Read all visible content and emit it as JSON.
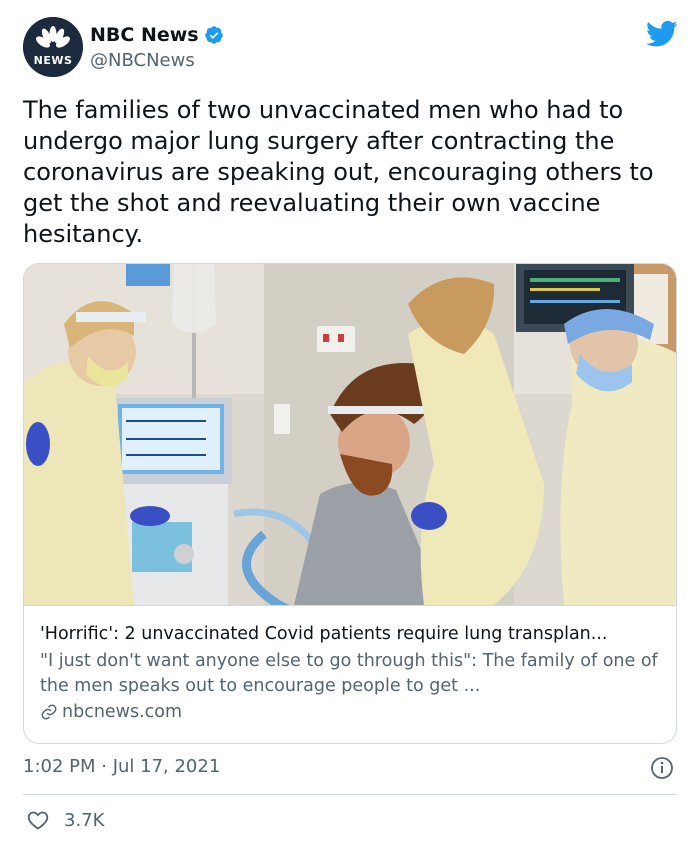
{
  "author": {
    "display_name": "NBC News",
    "handle": "@NBCNews",
    "avatar_text": "NEWS",
    "verified": true
  },
  "tweet": {
    "text": "The families of two unvaccinated men who had to undergo major lung surgery after contracting the coronavirus are speaking out, encouraging others to get the shot and reevaluating their own vaccine hesitancy.",
    "timestamp": "1:02 PM · Jul 17, 2021",
    "like_count": "3.7K"
  },
  "card": {
    "title": "'Horrific': 2 unvaccinated Covid patients require lung transplan...",
    "description": "\"I just don't want anyone else to go through this\": The family of one of the men speaks out to encourage people to get ...",
    "domain": "nbcnews.com"
  },
  "icons": {
    "logo": "twitter-bird-icon",
    "verified": "verified-badge-icon",
    "link": "link-icon",
    "info": "info-icon",
    "like": "heart-icon"
  },
  "colors": {
    "twitter_blue": "#1d9bf0",
    "text_primary": "#0f1419",
    "text_secondary": "#536471",
    "border": "#cfd9de",
    "avatar_bg": "#1c2a3d"
  }
}
